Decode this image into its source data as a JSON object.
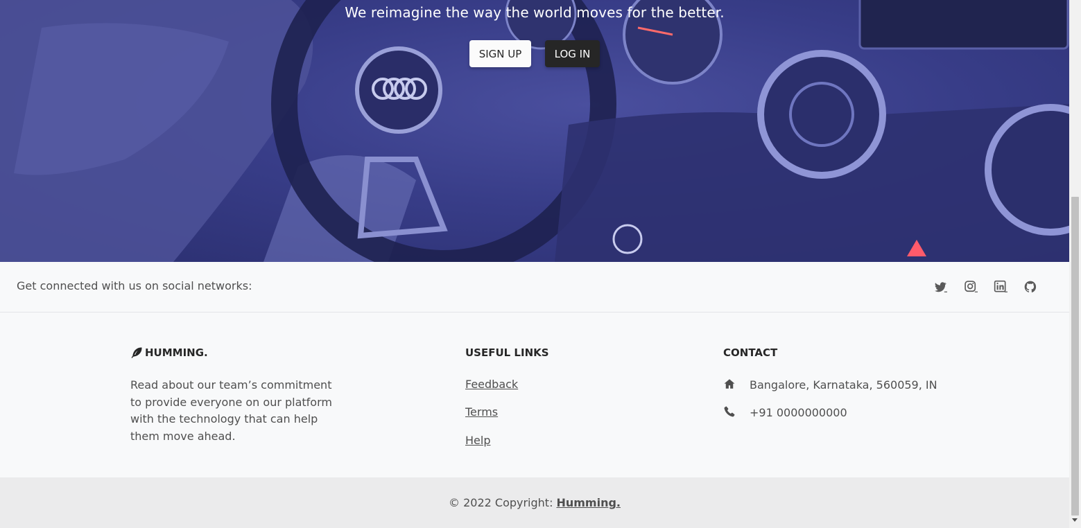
{
  "hero": {
    "tagline": "We reimagine the way the world moves for the better.",
    "signup_label": "SIGN UP",
    "login_label": "LOG IN"
  },
  "social": {
    "text": "Get connected with us on social networks:",
    "icons": [
      "twitter-icon",
      "instagram-icon",
      "linkedin-icon",
      "github-icon"
    ]
  },
  "brand": {
    "name": "HUMMING.",
    "icon": "feather-icon",
    "description": "Read about our team’s commitment to provide everyone on our platform with the technology that can help them move ahead."
  },
  "useful_links": {
    "title": "USEFUL LINKS",
    "items": [
      "Feedback",
      "Terms",
      "Help"
    ]
  },
  "contact": {
    "title": "CONTACT",
    "address": "Bangalore, Karnataka, 560059, IN",
    "phone": "+91 0000000000"
  },
  "copyright": {
    "text": "© 2022 Copyright:",
    "link": "Humming."
  },
  "colors": {
    "hero_tint": "#383d88",
    "footer_bg": "#f8f9fa",
    "copyright_bg": "#ebebec",
    "dark_button": "#262626"
  }
}
